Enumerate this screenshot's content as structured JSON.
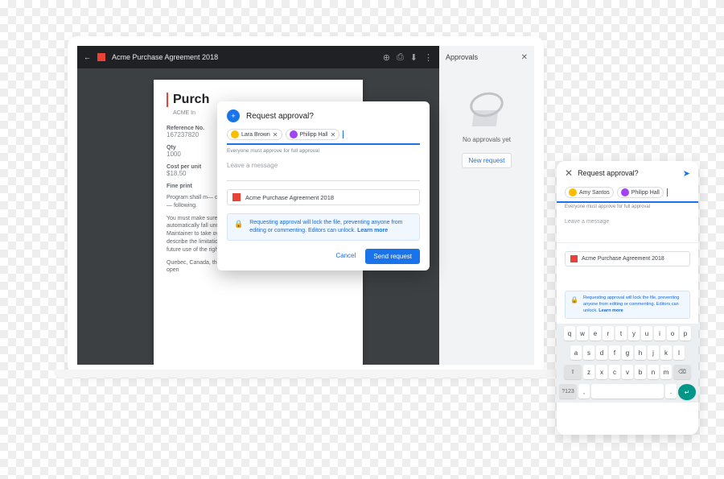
{
  "pdf": {
    "title": "Acme Purchase Agreement 2018",
    "heading": "Purch",
    "subtitle": "ACME In",
    "ref_label": "Reference No.",
    "ref_value": "167237820",
    "qty_label": "Qty",
    "qty_value": "1000",
    "cpu_label": "Cost per unit",
    "cpu_value": "$18.50",
    "fp_label": "Fine print",
    "fp1": "Program shall m— conditions of th— provision of this t— Derivative Work— following.",
    "para2": "You must make sure that you charge for Distributing this Package do not automatically fall under the terms of 3b) or 4), then that Current Maintainer to take over maintenance. Work includes a case where You describe the limitations and the definitions are repeated for your past or future use of the rights granted by this license.",
    "para3": "Quebec, Canada, the following acknowledgment: \"This product includes open"
  },
  "sidepanel": {
    "title": "Approvals",
    "empty": "No approvals yet",
    "button": "New request"
  },
  "dialog": {
    "title": "Request approval?",
    "approvers": [
      {
        "name": "Lara Brown"
      },
      {
        "name": "Philipp Hall"
      }
    ],
    "helper": "Everyone must approve for full approval",
    "message_placeholder": "Leave a message",
    "attachment": "Acme Purchase Agreement 2018",
    "info_text": "Requesting approval will lock the file, preventing anyone from editing or commenting. Editors can unlock. ",
    "info_link": "Learn more",
    "cancel": "Cancel",
    "send": "Send request"
  },
  "mobile": {
    "title": "Request approval?",
    "approvers": [
      {
        "name": "Amy Santos"
      },
      {
        "name": "Philipp Hall"
      }
    ],
    "helper": "Everyone must approve for full approval",
    "message_placeholder": "Leave a message",
    "attachment": "Acme Purchase Agreement 2018",
    "info_text": "Requesting approval will lock the file, preventing anyone from editing or commenting. Editors can unlock. ",
    "info_link": "Learn more"
  },
  "keyboard": {
    "row1": [
      "q",
      "w",
      "e",
      "r",
      "t",
      "y",
      "u",
      "i",
      "o",
      "p"
    ],
    "row2": [
      "a",
      "s",
      "d",
      "f",
      "g",
      "h",
      "j",
      "k",
      "l"
    ],
    "row3": [
      "z",
      "x",
      "c",
      "v",
      "b",
      "n",
      "m"
    ],
    "shift": "⇧",
    "backspace": "⌫",
    "numkey": "?123",
    "comma": ",",
    "period": ".",
    "enter": "↵"
  }
}
